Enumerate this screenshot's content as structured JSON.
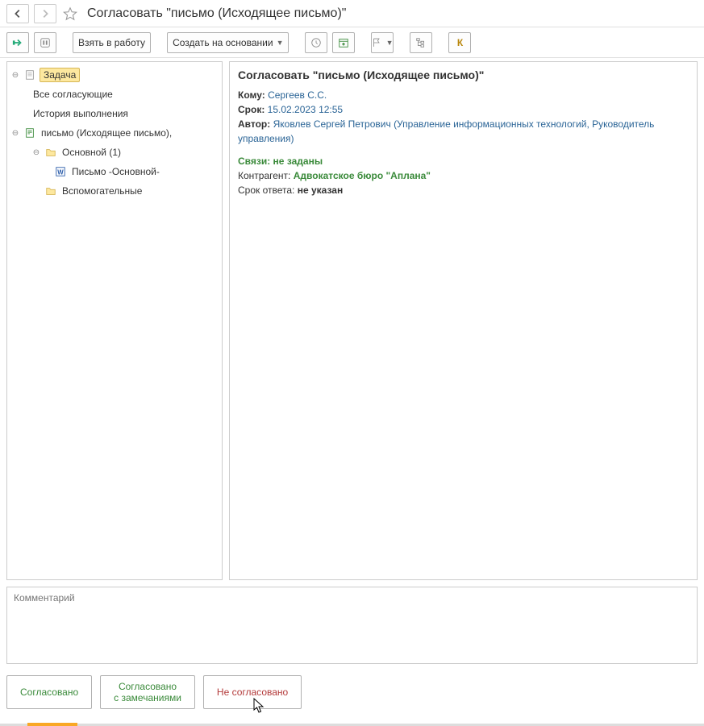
{
  "title": "Согласовать \"письмо (Исходящее письмо)\"",
  "toolbar": {
    "take_work": "Взять в работу",
    "create_based": "Создать на основании",
    "k_label": "К"
  },
  "tree": {
    "task": "Задача",
    "all_approvers": "Все согласующие",
    "history": "История выполнения",
    "letter": "письмо (Исходящее письмо),",
    "main_folder": "Основной (1)",
    "letter_file": "Письмо -Основной-",
    "aux_folder": "Вспомогательные"
  },
  "detail": {
    "title": "Согласовать \"письмо (Исходящее письмо)\"",
    "to_label": "Кому:",
    "to_value": "Сергеев С.С.",
    "deadline_label": "Срок:",
    "deadline_value": "15.02.2023 12:55",
    "author_label": "Автор:",
    "author_value": "Яковлев Сергей Петрович (Управление информационных технологий, Руководитель управления)",
    "links": "Связи: не заданы",
    "counterparty_label": "Контрагент:",
    "counterparty_value": "Адвокатское бюро \"Аплана\"",
    "reply_deadline_label": "Срок ответа:",
    "reply_deadline_value": "не указан"
  },
  "comment_placeholder": "Комментарий",
  "actions": {
    "approve": "Согласовано",
    "approve_with_notes_l1": "Согласовано",
    "approve_with_notes_l2": "с замечаниями",
    "reject": "Не согласовано"
  }
}
